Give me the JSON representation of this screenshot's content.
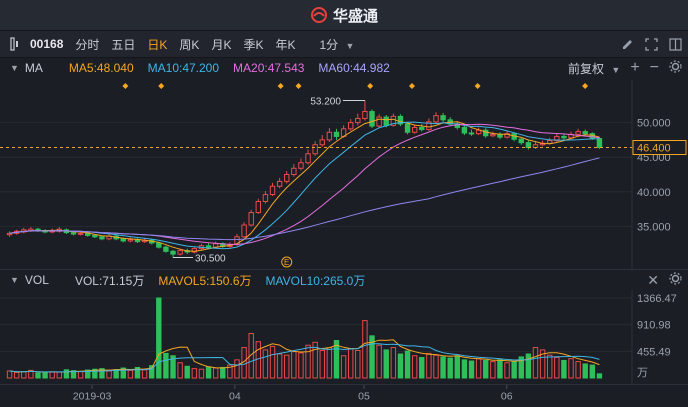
{
  "brand": {
    "name": "华盛通"
  },
  "toolbar": {
    "code": "00168",
    "periods": [
      "分时",
      "五日",
      "日K",
      "周K",
      "月K",
      "季K",
      "年K"
    ],
    "active_period": "日K",
    "minute_select": "1分"
  },
  "price_panel": {
    "indicator": "MA",
    "ma5": "MA5:48.040",
    "ma10": "MA10:47.200",
    "ma20": "MA20:47.543",
    "ma60": "MA60:44.982",
    "adjust": "前复权",
    "y_ticks": [
      "50.000",
      "45.000",
      "40.000",
      "35.000"
    ],
    "current_price": "46.400",
    "high_label": "53.200",
    "low_label": "30.500",
    "event_marker": "E"
  },
  "volume_panel": {
    "indicator": "VOL",
    "vol": "VOL:71.15万",
    "mavol5": "MAVOL5:150.6万",
    "mavol10": "MAVOL10:265.0万",
    "y_ticks": [
      "1366.47",
      "910.98",
      "455.49"
    ],
    "unit": "万"
  },
  "date_axis": {
    "labels": [
      "2019-03",
      "04",
      "05",
      "06"
    ]
  },
  "colors": {
    "up": "#e84a4a",
    "down": "#2fbf5a",
    "ma5": "#f5a623",
    "ma10": "#3fb5e6",
    "ma20": "#e66ee0",
    "ma60": "#8e87f0",
    "accent": "#f5a623"
  },
  "chart_data": {
    "type": "candlestick",
    "x": [
      "2019-02-15",
      "2019-02-18",
      "2019-02-19",
      "2019-02-20",
      "2019-02-21",
      "2019-02-22",
      "2019-02-25",
      "2019-02-26",
      "2019-02-27",
      "2019-02-28",
      "2019-03-01",
      "2019-03-04",
      "2019-03-05",
      "2019-03-06",
      "2019-03-07",
      "2019-03-08",
      "2019-03-11",
      "2019-03-12",
      "2019-03-13",
      "2019-03-14",
      "2019-03-15",
      "2019-03-18",
      "2019-03-19",
      "2019-03-20",
      "2019-03-21",
      "2019-03-22",
      "2019-03-25",
      "2019-03-26",
      "2019-03-27",
      "2019-03-28",
      "2019-03-29",
      "2019-04-01",
      "2019-04-02",
      "2019-04-03",
      "2019-04-04",
      "2019-04-08",
      "2019-04-09",
      "2019-04-10",
      "2019-04-11",
      "2019-04-12",
      "2019-04-15",
      "2019-04-16",
      "2019-04-17",
      "2019-04-18",
      "2019-04-23",
      "2019-04-24",
      "2019-04-25",
      "2019-04-26",
      "2019-04-29",
      "2019-04-30",
      "2019-05-02",
      "2019-05-03",
      "2019-05-06",
      "2019-05-07",
      "2019-05-08",
      "2019-05-09",
      "2019-05-10",
      "2019-05-14",
      "2019-05-15",
      "2019-05-16",
      "2019-05-17",
      "2019-05-20",
      "2019-05-21",
      "2019-05-22",
      "2019-05-23",
      "2019-05-24",
      "2019-05-27",
      "2019-05-28",
      "2019-05-29",
      "2019-05-30",
      "2019-05-31",
      "2019-06-03",
      "2019-06-04",
      "2019-06-05",
      "2019-06-06",
      "2019-06-10",
      "2019-06-11",
      "2019-06-12",
      "2019-06-13",
      "2019-06-14",
      "2019-06-17",
      "2019-06-18",
      "2019-06-19",
      "2019-06-20"
    ],
    "open": [
      33.8,
      34.0,
      34.2,
      34.4,
      34.6,
      34.4,
      34.2,
      34.3,
      34.5,
      34.1,
      33.9,
      34.0,
      33.7,
      33.5,
      33.2,
      33.6,
      33.2,
      32.9,
      33.1,
      32.8,
      33.0,
      32.6,
      32.0,
      31.4,
      31.0,
      31.5,
      31.3,
      31.8,
      32.2,
      32.0,
      32.5,
      32.1,
      32.4,
      33.5,
      35.2,
      37.0,
      38.6,
      39.6,
      40.8,
      41.5,
      42.5,
      43.4,
      44.2,
      45.5,
      46.8,
      47.5,
      48.6,
      48.0,
      49.1,
      50.0,
      50.6,
      51.6,
      49.5,
      50.8,
      49.6,
      50.9,
      49.8,
      48.6,
      49.3,
      49.0,
      50.1,
      51.0,
      50.4,
      49.8,
      49.3,
      48.5,
      48.4,
      48.9,
      48.1,
      48.3,
      47.9,
      48.4,
      47.6,
      47.1,
      46.4,
      46.8,
      47.0,
      47.4,
      48.0,
      47.8,
      48.3,
      48.7,
      48.4,
      47.7
    ],
    "close": [
      34.0,
      34.3,
      34.5,
      34.6,
      34.4,
      34.2,
      34.4,
      34.6,
      34.1,
      33.9,
      34.0,
      33.7,
      33.5,
      33.2,
      33.6,
      33.2,
      32.9,
      33.1,
      32.8,
      33.0,
      32.6,
      32.0,
      31.4,
      31.0,
      31.5,
      31.3,
      31.8,
      32.2,
      32.0,
      32.5,
      32.1,
      32.4,
      33.5,
      35.2,
      37.0,
      38.6,
      39.6,
      40.8,
      41.5,
      42.5,
      43.4,
      44.2,
      45.5,
      46.8,
      47.5,
      48.6,
      48.0,
      49.1,
      50.0,
      50.6,
      51.6,
      49.5,
      50.8,
      49.6,
      50.9,
      49.8,
      48.6,
      49.3,
      49.0,
      50.1,
      51.0,
      50.4,
      49.8,
      49.3,
      48.5,
      48.4,
      48.9,
      48.1,
      48.3,
      47.9,
      48.4,
      47.6,
      47.1,
      46.4,
      46.8,
      47.0,
      47.4,
      48.0,
      47.8,
      48.3,
      48.7,
      48.4,
      47.7,
      46.4
    ],
    "high": [
      34.3,
      34.5,
      34.8,
      34.9,
      34.8,
      34.6,
      34.7,
      34.9,
      34.7,
      34.3,
      34.3,
      34.2,
      33.9,
      33.6,
      33.9,
      33.8,
      33.4,
      33.4,
      33.3,
      33.3,
      33.2,
      32.8,
      32.2,
      31.6,
      31.8,
      31.8,
      32.0,
      32.5,
      32.6,
      32.8,
      32.7,
      32.7,
      33.9,
      35.6,
      37.4,
      39.0,
      40.1,
      41.3,
      42.0,
      43.0,
      44.0,
      44.8,
      46.1,
      47.3,
      48.2,
      49.2,
      49.1,
      49.6,
      50.5,
      51.3,
      53.2,
      51.9,
      51.2,
      51.1,
      51.3,
      51.2,
      50.1,
      49.7,
      49.8,
      50.6,
      51.5,
      51.4,
      50.8,
      50.2,
      49.6,
      49.0,
      49.3,
      49.2,
      48.7,
      48.6,
      48.8,
      48.6,
      47.9,
      47.4,
      47.2,
      47.4,
      47.8,
      48.4,
      48.3,
      48.7,
      49.1,
      49.0,
      48.6,
      47.9
    ],
    "low": [
      33.5,
      33.8,
      34.0,
      34.2,
      34.2,
      34.0,
      34.0,
      34.1,
      33.9,
      33.7,
      33.7,
      33.5,
      33.3,
      33.0,
      33.0,
      33.0,
      32.7,
      32.7,
      32.6,
      32.6,
      32.4,
      31.8,
      31.2,
      30.5,
      30.8,
      31.0,
      31.1,
      31.6,
      31.8,
      31.8,
      31.9,
      31.9,
      32.2,
      33.3,
      35.0,
      36.8,
      38.3,
      39.4,
      40.5,
      41.2,
      42.2,
      43.1,
      43.9,
      45.2,
      46.5,
      47.2,
      47.5,
      47.8,
      48.8,
      49.6,
      50.3,
      49.2,
      49.3,
      49.3,
      49.4,
      49.5,
      48.3,
      48.4,
      48.7,
      48.8,
      49.8,
      50.0,
      49.5,
      49.0,
      48.2,
      48.1,
      48.2,
      47.8,
      47.9,
      47.6,
      47.7,
      47.3,
      46.8,
      46.1,
      46.2,
      46.6,
      46.8,
      47.2,
      47.5,
      47.6,
      48.0,
      48.1,
      47.5,
      46.2
    ],
    "volume": [
      120,
      95,
      110,
      130,
      85,
      90,
      105,
      100,
      140,
      125,
      110,
      135,
      150,
      160,
      120,
      145,
      170,
      130,
      180,
      140,
      210,
      1366,
      420,
      380,
      260,
      200,
      160,
      150,
      190,
      170,
      180,
      220,
      310,
      520,
      760,
      620,
      480,
      540,
      410,
      390,
      450,
      430,
      560,
      610,
      470,
      520,
      640,
      380,
      500,
      470,
      980,
      720,
      560,
      480,
      520,
      410,
      460,
      380,
      350,
      420,
      390,
      360,
      340,
      380,
      310,
      290,
      330,
      300,
      280,
      310,
      260,
      280,
      360,
      410,
      520,
      480,
      390,
      350,
      300,
      330,
      280,
      240,
      220,
      71.15
    ],
    "ylim": [
      30,
      55
    ]
  }
}
